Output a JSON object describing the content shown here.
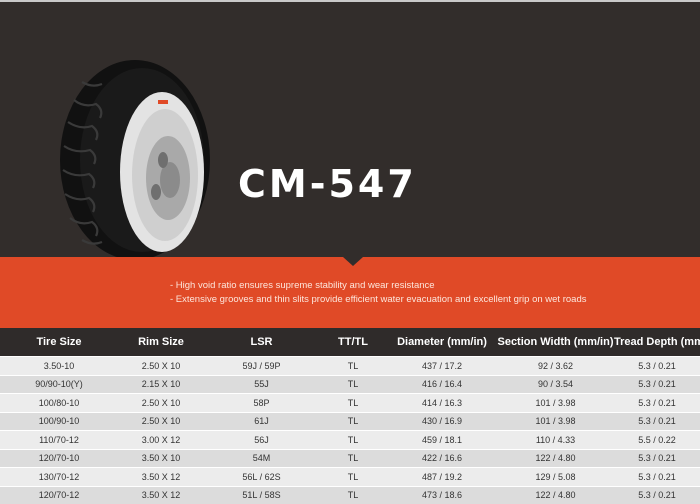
{
  "model": "CM-547",
  "features": [
    "- High void ratio ensures supreme stability and wear resistance",
    "- Extensive grooves and thin slits provide efficient water evacuation and excellent grip on wet roads"
  ],
  "colors": {
    "hero_bg": "#322d2b",
    "accent": "#e04a27",
    "header_bg": "#2f2b2a",
    "row_light": "#ececec",
    "row_dark": "#dcdcdc"
  },
  "table": {
    "headers": [
      "Tire Size",
      "Rim Size",
      "LSR",
      "TT/TL",
      "Diameter (mm/in)",
      "Section Width (mm/in)",
      "Tread Depth (mm/in)"
    ],
    "rows": [
      [
        "3.50-10",
        "2.50 X 10",
        "59J  /  59P",
        "TL",
        "437 / 17.2",
        "92 / 3.62",
        "5.3 / 0.21"
      ],
      [
        "90/90-10(Y)",
        "2.15 X 10",
        "55J",
        "TL",
        "416 / 16.4",
        "90 / 3.54",
        "5.3 / 0.21"
      ],
      [
        "100/80-10",
        "2.50 X 10",
        "58P",
        "TL",
        "414 / 16.3",
        "101 / 3.98",
        "5.3 / 0.21"
      ],
      [
        "100/90-10",
        "2.50 X 10",
        "61J",
        "TL",
        "430 / 16.9",
        "101 / 3.98",
        "5.3 / 0.21"
      ],
      [
        "110/70-12",
        "3.00 X 12",
        "56J",
        "TL",
        "459 / 18.1",
        "110 / 4.33",
        "5.5 / 0.22"
      ],
      [
        "120/70-10",
        "3.50 X 10",
        "54M",
        "TL",
        "422 / 16.6",
        "122 / 4.80",
        "5.3 / 0.21"
      ],
      [
        "130/70-12",
        "3.50 X 12",
        "56L  /  62S",
        "TL",
        "487 / 19.2",
        "129 / 5.08",
        "5.3 / 0.21"
      ],
      [
        "120/70-12",
        "3.50 X 12",
        "51L  /  58S",
        "TL",
        "473 / 18.6",
        "122 / 4.80",
        "5.3 / 0.21"
      ]
    ]
  }
}
